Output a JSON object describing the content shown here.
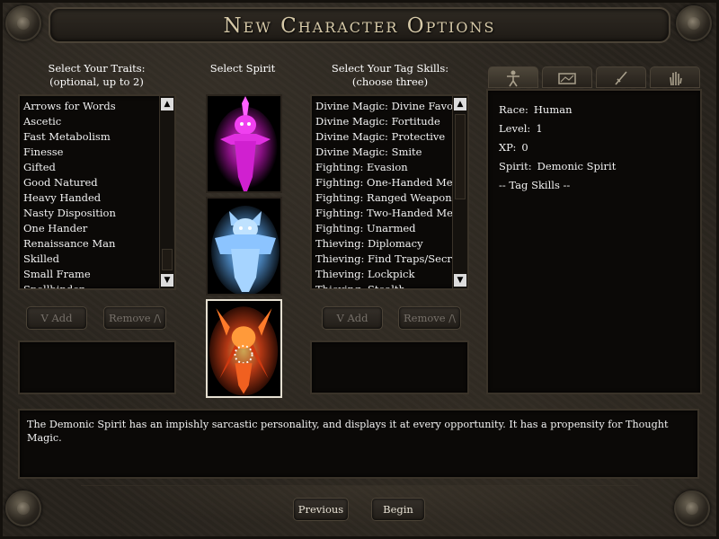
{
  "title": "New Character Options",
  "traits": {
    "header_line1": "Select Your Traits:",
    "header_line2": "(optional, up to 2)",
    "items": [
      "Arrows for Words",
      "Ascetic",
      "Fast Metabolism",
      "Finesse",
      "Gifted",
      "Good Natured",
      "Heavy Handed",
      "Nasty Disposition",
      "One Hander",
      "Renaissance Man",
      "Skilled",
      "Small Frame",
      "Spellbinder"
    ],
    "add_label": "V Add",
    "remove_label": "Remove /\\"
  },
  "spirit": {
    "header": "Select Spirit",
    "options": [
      {
        "name": "pink-spirit",
        "color": "#d81ed0",
        "selected": false
      },
      {
        "name": "blue-spirit",
        "color": "#6fb6ff",
        "selected": false
      },
      {
        "name": "demonic-spirit",
        "color": "#e0461a",
        "selected": true
      }
    ]
  },
  "tag_skills": {
    "header_line1": "Select Your Tag Skills:",
    "header_line2": "(choose three)",
    "items": [
      "Divine Magic: Divine Favor",
      "Divine Magic: Fortitude",
      "Divine Magic: Protective",
      "Divine Magic: Smite",
      "Fighting: Evasion",
      "Fighting: One-Handed Melee",
      "Fighting: Ranged Weapons",
      "Fighting: Two-Handed Melee",
      "Fighting: Unarmed",
      "Thieving: Diplomacy",
      "Thieving: Find Traps/Secret Doors",
      "Thieving: Lockpick",
      "Thieving: Stealth"
    ],
    "add_label": "V Add",
    "remove_label": "Remove /\\"
  },
  "tabs": [
    {
      "name": "tab-character",
      "icon": "figure-icon"
    },
    {
      "name": "tab-portrait",
      "icon": "image-icon"
    },
    {
      "name": "tab-weapons",
      "icon": "sword-icon"
    },
    {
      "name": "tab-hand",
      "icon": "hand-icon"
    }
  ],
  "info": {
    "race_label": "Race:",
    "race": "Human",
    "level_label": "Level:",
    "level": "1",
    "xp_label": "XP:",
    "xp": "0",
    "spirit_label": "Spirit:",
    "spirit": "Demonic Spirit",
    "tag_skills_heading": "-- Tag Skills --"
  },
  "description": "The Demonic Spirit has an impishly sarcastic personality, and displays it at every opportunity. It has a propensity for Thought Magic.",
  "nav": {
    "previous_label": "Previous",
    "begin_label": "Begin"
  },
  "colors": {
    "title": "#d6c9a8",
    "panel_bg": "#0b0907",
    "frame_bg": "#29241e",
    "disabled_text": "#77716a"
  }
}
